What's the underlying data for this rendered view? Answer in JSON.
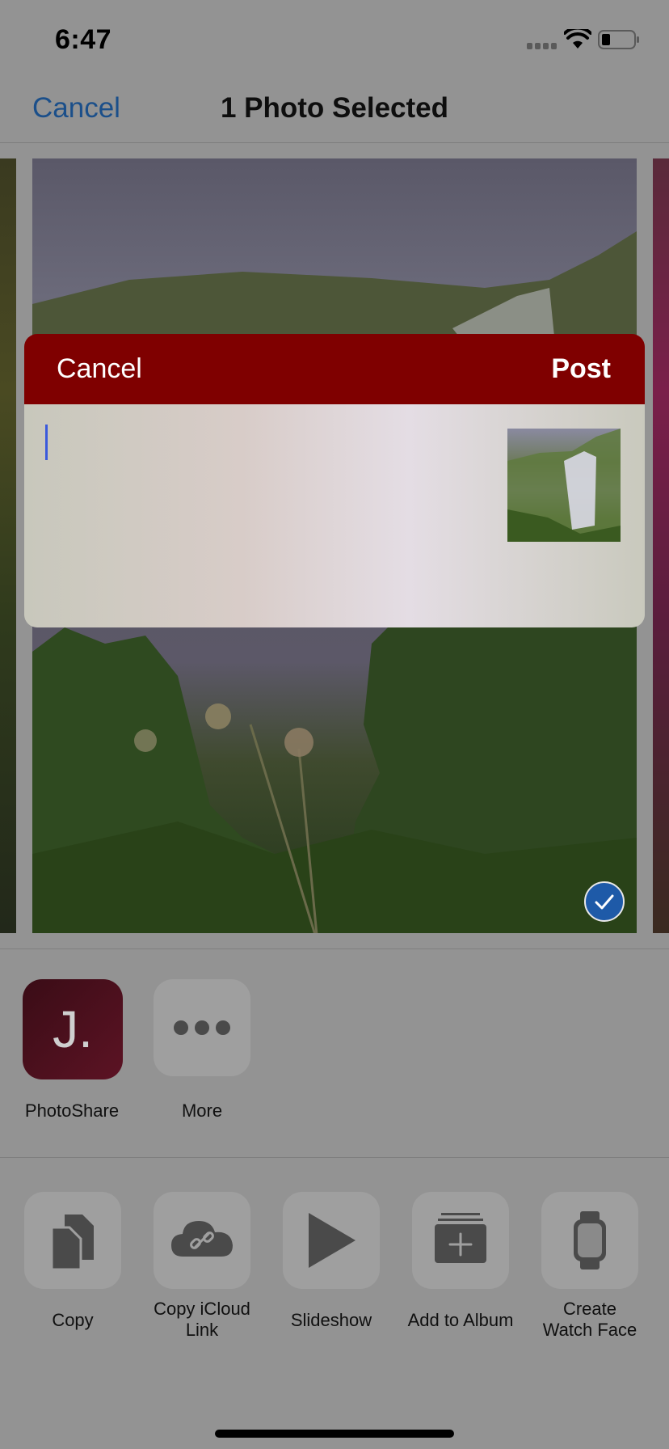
{
  "status_bar": {
    "time": "6:47"
  },
  "nav": {
    "cancel_label": "Cancel",
    "title": "1 Photo Selected"
  },
  "post_dialog": {
    "cancel_label": "Cancel",
    "post_label": "Post",
    "text_value": ""
  },
  "apps": [
    {
      "label": "PhotoShare",
      "icon_text": "J."
    },
    {
      "label": "More"
    }
  ],
  "actions": [
    {
      "label": "Copy"
    },
    {
      "label": "Copy iCloud Link",
      "line1": "Copy iCloud",
      "line2": "Link"
    },
    {
      "label": "Slideshow"
    },
    {
      "label": "Add to Album"
    },
    {
      "label": "Create Watch Face",
      "line1": "Create",
      "line2": "Watch Face"
    }
  ],
  "colors": {
    "dim_background": "#939393",
    "dialog_header": "#7f0000",
    "link_blue": "#1b4f8a",
    "check_blue": "#1e5aa8"
  }
}
